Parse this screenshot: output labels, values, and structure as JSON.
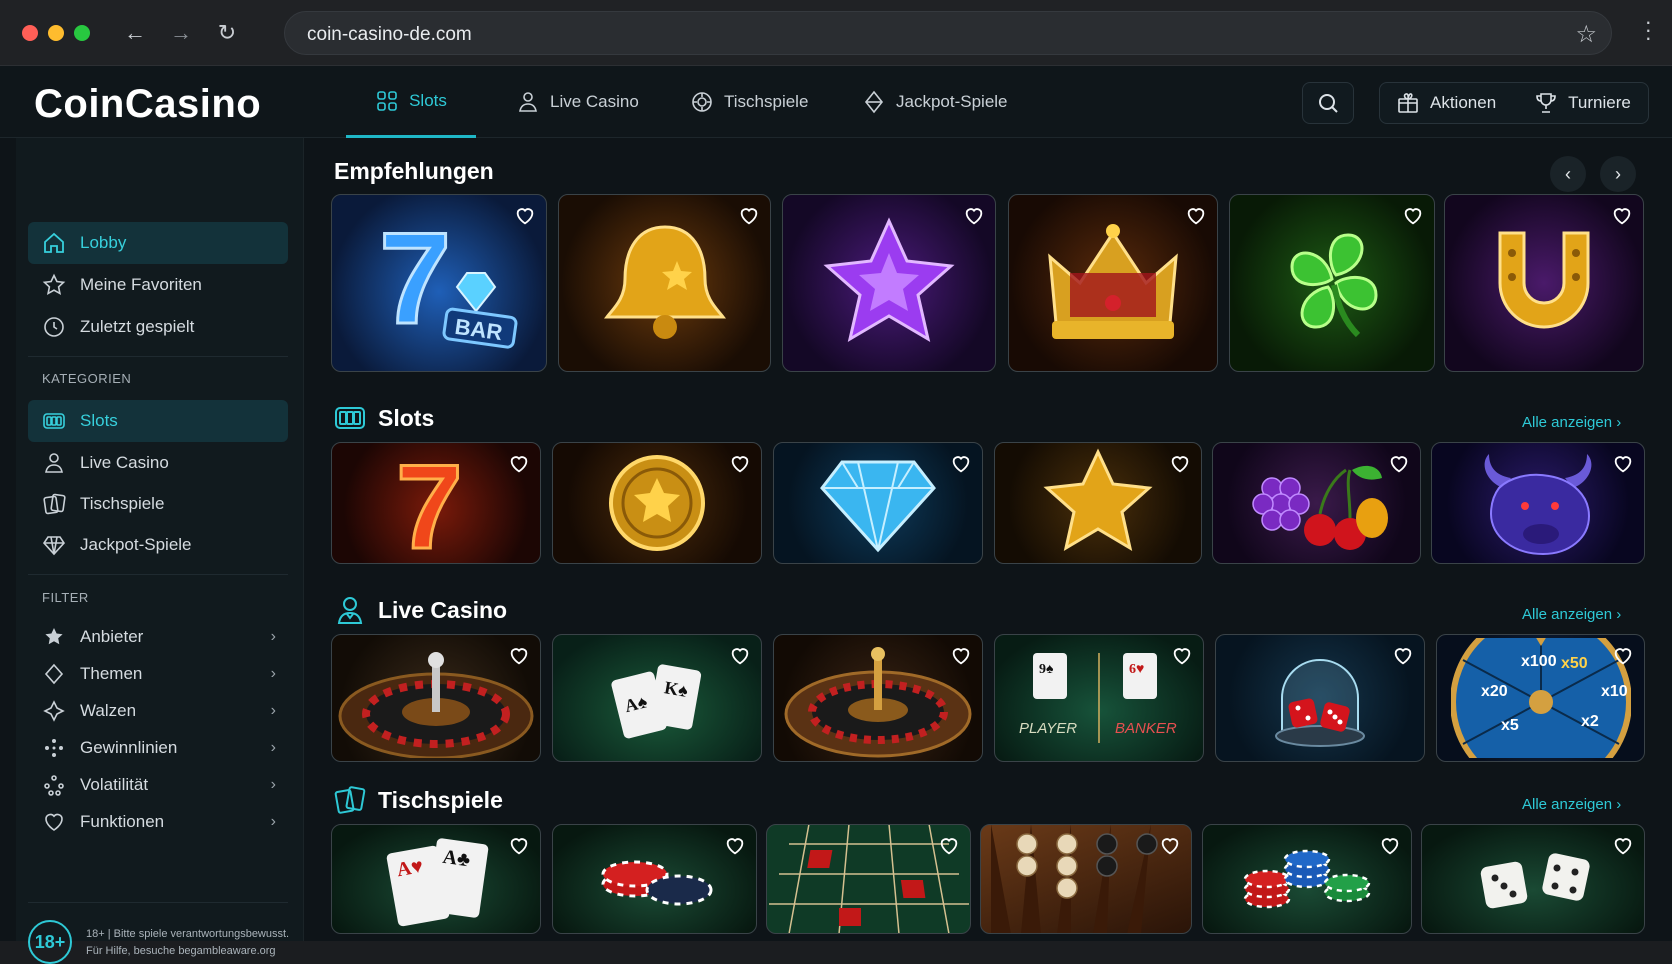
{
  "browser": {
    "url": "coin-casino-de.com"
  },
  "brand": {
    "logo": "CoinCasino",
    "accent": "#2ec9d6"
  },
  "topnav": {
    "tabs": [
      {
        "label": "Slots",
        "icon": "slot-machine-icon",
        "active": true
      },
      {
        "label": "Live Casino",
        "icon": "dealer-icon"
      },
      {
        "label": "Tischspiele",
        "icon": "chip-icon"
      },
      {
        "label": "Jackpot-Spiele",
        "icon": "diamond-icon"
      }
    ],
    "promotions_label": "Aktionen",
    "tournaments_label": "Turniere"
  },
  "sidebar": {
    "main_items": [
      {
        "label": "Lobby",
        "icon": "home-icon",
        "active": true
      },
      {
        "label": "Meine Favoriten",
        "icon": "star-icon"
      },
      {
        "label": "Zuletzt gespielt",
        "icon": "clock-icon"
      }
    ],
    "categories_heading": "KATEGORIEN",
    "categories": [
      {
        "label": "Slots",
        "icon": "slot-machine-icon",
        "active": true
      },
      {
        "label": "Live Casino",
        "icon": "dealer-icon"
      },
      {
        "label": "Tischspiele",
        "icon": "cards-icon"
      },
      {
        "label": "Jackpot-Spiele",
        "icon": "diamond-icon"
      }
    ],
    "filter_heading": "FILTER",
    "filters": [
      {
        "label": "Anbieter",
        "icon": "star-filled-icon"
      },
      {
        "label": "Themen",
        "icon": "diamond-outline-icon"
      },
      {
        "label": "Walzen",
        "icon": "reels-icon"
      },
      {
        "label": "Gewinnlinien",
        "icon": "lines-icon"
      },
      {
        "label": "Volatilität",
        "icon": "volatility-icon"
      },
      {
        "label": "Funktionen",
        "icon": "heart-icon"
      }
    ],
    "age_badge": "18+",
    "responsible_line1": "18+ | Bitte spiele verantwortungsbewusst.",
    "responsible_line2": "Für Hilfe, besuche begambleaware.org"
  },
  "sections": {
    "featured_title": "Empfehlungen",
    "slots_title": "Slots",
    "live_title": "Live Casino",
    "table_title": "Tischspiele",
    "see_all": "Alle anzeigen"
  },
  "cards": {
    "featured": [
      "seven-bar-icon",
      "bell-icon",
      "purple-star-icon",
      "crown-icon",
      "clover-icon",
      "horseshoe-icon"
    ],
    "slots": [
      "red-seven-icon",
      "gold-coin-icon",
      "diamond-gem-icon",
      "gold-star-icon",
      "fruits-icon",
      "buffalo-icon"
    ],
    "live": [
      "roulette-icon",
      "blackjack-icon",
      "roulette-wheel-icon",
      "baccarat-icon",
      "dice-dome-icon",
      "money-wheel-icon"
    ],
    "table": [
      "aces-cards-icon",
      "poker-chips-icon",
      "roulette-table-icon",
      "backgammon-icon",
      "chip-stacks-icon",
      "dice-icon"
    ]
  },
  "baccarat": {
    "player": "PLAYER",
    "banker": "BANKER"
  },
  "wheel": {
    "labels": [
      "x100",
      "x50",
      "x20",
      "x10",
      "x5",
      "x2"
    ]
  },
  "bar_label": "BAR"
}
